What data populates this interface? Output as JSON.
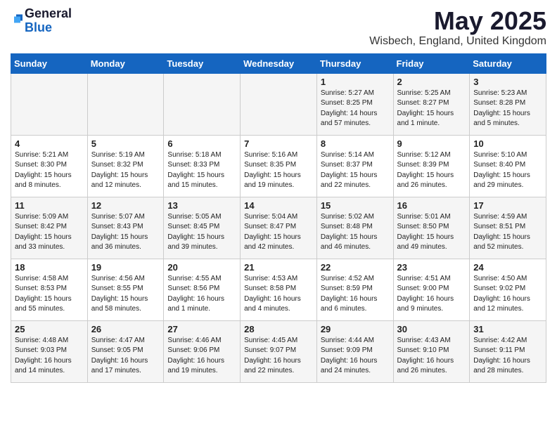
{
  "header": {
    "logo_general": "General",
    "logo_blue": "Blue",
    "month_title": "May 2025",
    "location": "Wisbech, England, United Kingdom"
  },
  "days_of_week": [
    "Sunday",
    "Monday",
    "Tuesday",
    "Wednesday",
    "Thursday",
    "Friday",
    "Saturday"
  ],
  "weeks": [
    [
      {
        "day": "",
        "info": ""
      },
      {
        "day": "",
        "info": ""
      },
      {
        "day": "",
        "info": ""
      },
      {
        "day": "",
        "info": ""
      },
      {
        "day": "1",
        "info": "Sunrise: 5:27 AM\nSunset: 8:25 PM\nDaylight: 14 hours\nand 57 minutes."
      },
      {
        "day": "2",
        "info": "Sunrise: 5:25 AM\nSunset: 8:27 PM\nDaylight: 15 hours\nand 1 minute."
      },
      {
        "day": "3",
        "info": "Sunrise: 5:23 AM\nSunset: 8:28 PM\nDaylight: 15 hours\nand 5 minutes."
      }
    ],
    [
      {
        "day": "4",
        "info": "Sunrise: 5:21 AM\nSunset: 8:30 PM\nDaylight: 15 hours\nand 8 minutes."
      },
      {
        "day": "5",
        "info": "Sunrise: 5:19 AM\nSunset: 8:32 PM\nDaylight: 15 hours\nand 12 minutes."
      },
      {
        "day": "6",
        "info": "Sunrise: 5:18 AM\nSunset: 8:33 PM\nDaylight: 15 hours\nand 15 minutes."
      },
      {
        "day": "7",
        "info": "Sunrise: 5:16 AM\nSunset: 8:35 PM\nDaylight: 15 hours\nand 19 minutes."
      },
      {
        "day": "8",
        "info": "Sunrise: 5:14 AM\nSunset: 8:37 PM\nDaylight: 15 hours\nand 22 minutes."
      },
      {
        "day": "9",
        "info": "Sunrise: 5:12 AM\nSunset: 8:39 PM\nDaylight: 15 hours\nand 26 minutes."
      },
      {
        "day": "10",
        "info": "Sunrise: 5:10 AM\nSunset: 8:40 PM\nDaylight: 15 hours\nand 29 minutes."
      }
    ],
    [
      {
        "day": "11",
        "info": "Sunrise: 5:09 AM\nSunset: 8:42 PM\nDaylight: 15 hours\nand 33 minutes."
      },
      {
        "day": "12",
        "info": "Sunrise: 5:07 AM\nSunset: 8:43 PM\nDaylight: 15 hours\nand 36 minutes."
      },
      {
        "day": "13",
        "info": "Sunrise: 5:05 AM\nSunset: 8:45 PM\nDaylight: 15 hours\nand 39 minutes."
      },
      {
        "day": "14",
        "info": "Sunrise: 5:04 AM\nSunset: 8:47 PM\nDaylight: 15 hours\nand 42 minutes."
      },
      {
        "day": "15",
        "info": "Sunrise: 5:02 AM\nSunset: 8:48 PM\nDaylight: 15 hours\nand 46 minutes."
      },
      {
        "day": "16",
        "info": "Sunrise: 5:01 AM\nSunset: 8:50 PM\nDaylight: 15 hours\nand 49 minutes."
      },
      {
        "day": "17",
        "info": "Sunrise: 4:59 AM\nSunset: 8:51 PM\nDaylight: 15 hours\nand 52 minutes."
      }
    ],
    [
      {
        "day": "18",
        "info": "Sunrise: 4:58 AM\nSunset: 8:53 PM\nDaylight: 15 hours\nand 55 minutes."
      },
      {
        "day": "19",
        "info": "Sunrise: 4:56 AM\nSunset: 8:55 PM\nDaylight: 15 hours\nand 58 minutes."
      },
      {
        "day": "20",
        "info": "Sunrise: 4:55 AM\nSunset: 8:56 PM\nDaylight: 16 hours\nand 1 minute."
      },
      {
        "day": "21",
        "info": "Sunrise: 4:53 AM\nSunset: 8:58 PM\nDaylight: 16 hours\nand 4 minutes."
      },
      {
        "day": "22",
        "info": "Sunrise: 4:52 AM\nSunset: 8:59 PM\nDaylight: 16 hours\nand 6 minutes."
      },
      {
        "day": "23",
        "info": "Sunrise: 4:51 AM\nSunset: 9:00 PM\nDaylight: 16 hours\nand 9 minutes."
      },
      {
        "day": "24",
        "info": "Sunrise: 4:50 AM\nSunset: 9:02 PM\nDaylight: 16 hours\nand 12 minutes."
      }
    ],
    [
      {
        "day": "25",
        "info": "Sunrise: 4:48 AM\nSunset: 9:03 PM\nDaylight: 16 hours\nand 14 minutes."
      },
      {
        "day": "26",
        "info": "Sunrise: 4:47 AM\nSunset: 9:05 PM\nDaylight: 16 hours\nand 17 minutes."
      },
      {
        "day": "27",
        "info": "Sunrise: 4:46 AM\nSunset: 9:06 PM\nDaylight: 16 hours\nand 19 minutes."
      },
      {
        "day": "28",
        "info": "Sunrise: 4:45 AM\nSunset: 9:07 PM\nDaylight: 16 hours\nand 22 minutes."
      },
      {
        "day": "29",
        "info": "Sunrise: 4:44 AM\nSunset: 9:09 PM\nDaylight: 16 hours\nand 24 minutes."
      },
      {
        "day": "30",
        "info": "Sunrise: 4:43 AM\nSunset: 9:10 PM\nDaylight: 16 hours\nand 26 minutes."
      },
      {
        "day": "31",
        "info": "Sunrise: 4:42 AM\nSunset: 9:11 PM\nDaylight: 16 hours\nand 28 minutes."
      }
    ]
  ]
}
